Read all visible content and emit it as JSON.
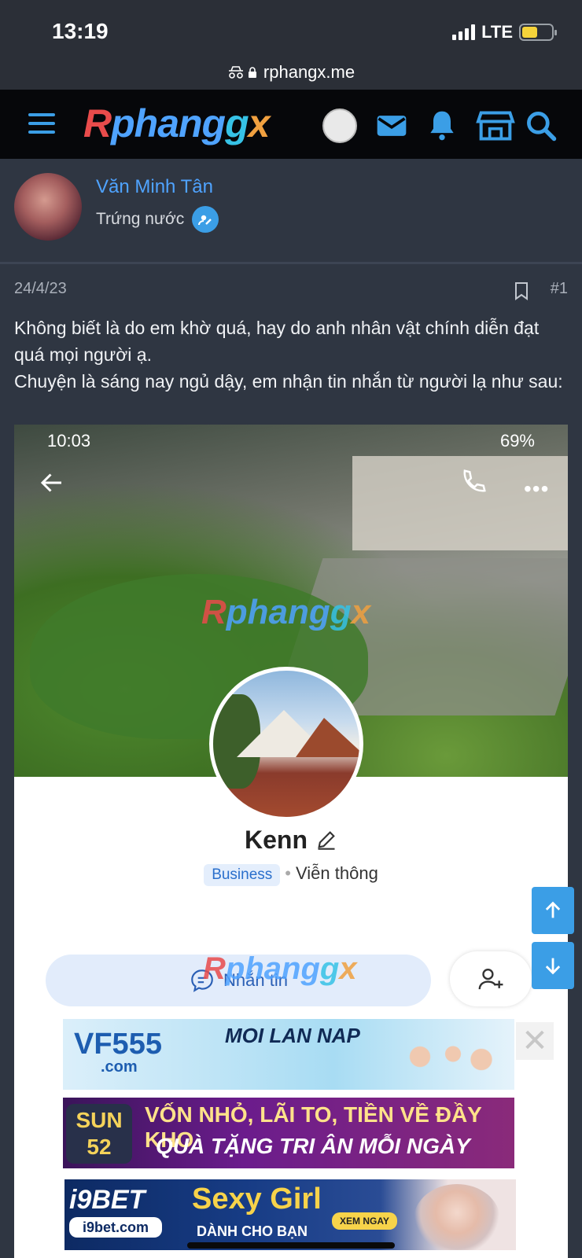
{
  "status_bar": {
    "time": "13:19",
    "network": "LTE"
  },
  "browser": {
    "url": "rphangx.me"
  },
  "site": {
    "logo_parts": [
      "R",
      "phang",
      "g",
      "x"
    ],
    "header_icons": [
      "menu-icon",
      "avatar",
      "mail-icon",
      "bell-icon",
      "store-icon",
      "search-icon"
    ]
  },
  "author": {
    "name": "Văn Minh Tân",
    "role": "Trứng nước"
  },
  "post": {
    "date": "24/4/23",
    "number": "#1",
    "paragraphs": [
      "Không biết là do em khờ quá, hay do anh nhân vật chính diễn đạt quá mọi người ạ.",
      "Chuyện là sáng nay ngủ dậy, em nhận tin nhắn từ người lạ như sau:"
    ]
  },
  "embedded_screenshot": {
    "time": "10:03",
    "battery": "69%",
    "profile_name": "Kenn",
    "tag": "Business",
    "category": "Viễn thông",
    "message_button": "Nhắn tin",
    "more_glyph": "•••"
  },
  "ads": {
    "ad1": {
      "brand": "VF555",
      "domain": ".com",
      "tagline": "MOI LAN NAP",
      "close": "✕"
    },
    "ad2": {
      "brand_top": "SUN",
      "brand_bottom": "52",
      "line1": "VỐN NHỎ, LÃI TO, TIỀN VỀ ĐẦY KHO",
      "line2": "QUÀ TẶNG TRI ÂN MỖI NGÀY"
    },
    "ad3": {
      "brand": "i9BET",
      "domain": "i9bet.com",
      "line1": "Sexy Girl",
      "line2": "DÀNH CHO BẠN",
      "cta": "XEM NGAY"
    }
  },
  "colors": {
    "accent": "#3b9ee6",
    "background": "#2f3642",
    "header": "#06070a"
  }
}
